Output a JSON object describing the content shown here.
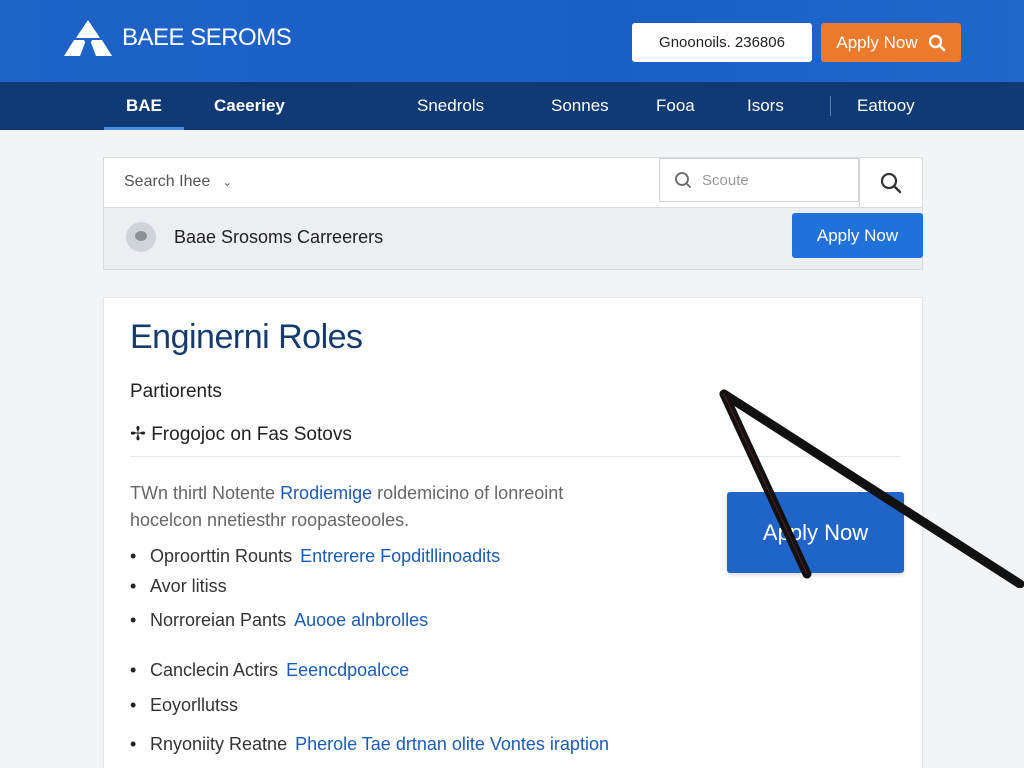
{
  "header": {
    "logo_text": "BAEE SEROMS",
    "phone": "Gnoonoils. 236806",
    "apply_label": "Apply Now"
  },
  "nav": {
    "items": [
      {
        "label": "BAE",
        "bold": true,
        "active": true
      },
      {
        "label": "Caeeriey",
        "bold": true
      },
      {
        "label": "Snedrols"
      },
      {
        "label": "Sonnes"
      },
      {
        "label": "Fooa"
      },
      {
        "label": "Isors"
      },
      {
        "label": "Eattooy"
      }
    ]
  },
  "search": {
    "select_label": "Search Ihee",
    "input_placeholder": "Scoute"
  },
  "careers_bar": {
    "text": "Baae Srosoms Carreerers",
    "apply_label": "Apply Now"
  },
  "card": {
    "title": "Enginerni Roles",
    "subtitle": "Partiorents",
    "subtitle2": "✢ Frogojoc on Fas Sotovs",
    "desc_line1_a": "TWn thirtl Notente",
    "desc_line1_link": "Rrodiemige",
    "desc_line1_b": "roldemicino of lonreoint",
    "desc_line2": "hocelcon nnetiesthr roopasteooles.",
    "apply_label": "Apply Now",
    "bullets": [
      {
        "text": "Oproorttin Rounts",
        "link": "Entrerere Fopditllinoadits"
      },
      {
        "text": "Avor litiss",
        "link": ""
      },
      {
        "text": "Norroreian Pants",
        "link": "Auooe alnbrolles"
      },
      {
        "text": "Canclecin Actirs",
        "link": "Eeencdpoalcce"
      },
      {
        "text": "Eoyorllutss",
        "link": ""
      },
      {
        "text": "Rnyoniity Reatne",
        "link": "Pherole Tae drtnan olite Vontes iraption"
      }
    ]
  },
  "colors": {
    "header_bg": "#1f63c9",
    "nav_bg": "#0f3a74",
    "accent_orange": "#ec7a2d",
    "accent_blue": "#1f72d9",
    "title_navy": "#153b6e",
    "link_blue": "#1b5bb7"
  },
  "icons": [
    "logo-mark-icon",
    "search-icon",
    "chevron-down-icon",
    "avatar-icon",
    "cursor-arrow-icon"
  ]
}
